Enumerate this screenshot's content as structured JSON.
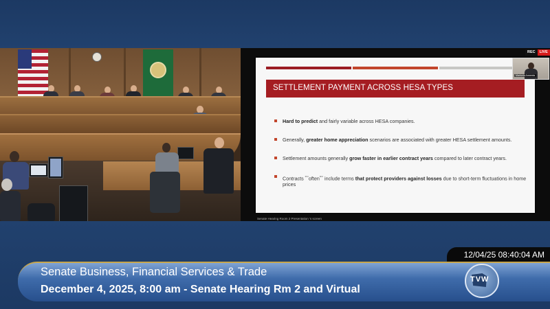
{
  "presentation": {
    "slide_title": "SETTLEMENT PAYMENT ACROSS HESA TYPES",
    "bullets": [
      {
        "bold": "Hard to predict",
        "text": " and fairly variable across HESA companies."
      },
      {
        "prefix": "Generally, ",
        "bold": "greater home appreciation",
        "text": " scenarios are associated with greater HESA settlement amounts."
      },
      {
        "prefix": "Settlement amounts generally ",
        "bold": "grow faster in earlier contract years",
        "text": " compared to later contract years."
      },
      {
        "prefix": "Contracts ",
        "sup1": "ᵇ⁽⁶⁾",
        "mid": "often",
        "sup2": "ᵇ⁽⁶⁾",
        "mid2": " include terms ",
        "bold": "that protect providers against losses",
        "text": " due to short-term fluctuations in home prices"
      }
    ],
    "caption": "Senate Hearing Room 2 Presentation 's screen",
    "accent_colors": [
      "#9b1c22",
      "#c2452b",
      "#c7c7c4"
    ]
  },
  "indicators": {
    "rec": "REC",
    "live": "LIVE",
    "pip_name": "Marisela Armenta"
  },
  "broadcast": {
    "timestamp": "12/04/25 08:40:04 AM",
    "title": "Senate Business, Financial Services & Trade",
    "subtitle": "December 4, 2025, 8:00 am - Senate Hearing Rm 2 and Virtual",
    "logo_text": "TVW"
  }
}
